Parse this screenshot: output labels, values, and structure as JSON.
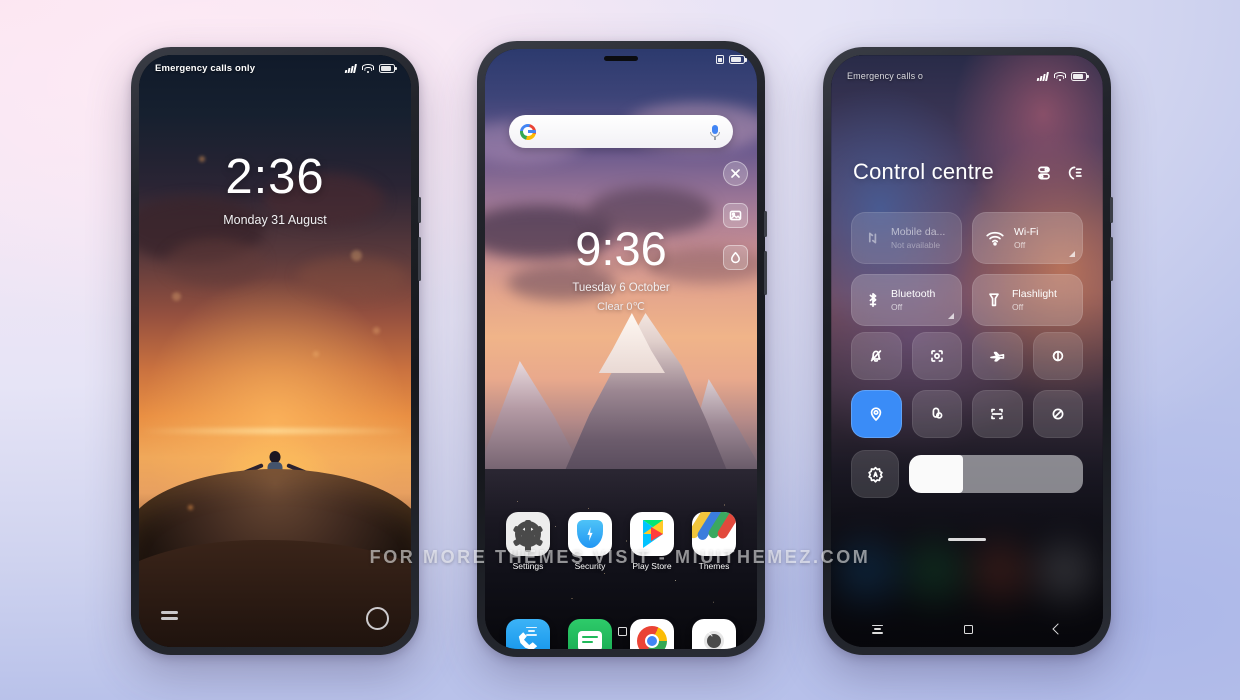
{
  "page": {
    "watermark": "FOR MORE THEMES VISIT - MIUITHEMEZ.COM",
    "bg_start": "#fae1ee",
    "bg_end": "#b6c0ea"
  },
  "lockscreen": {
    "status": {
      "carrier": "Emergency calls only"
    },
    "time": "2:36",
    "date": "Monday 31 August",
    "bottom_left_icon": "menu-icon",
    "bottom_right_icon": "camera-icon"
  },
  "homescreen": {
    "search": {
      "placeholder": "",
      "logo_icon": "google-icon",
      "mic_icon": "microphone-icon"
    },
    "time": "9:36",
    "date": "Tuesday 6 October",
    "weather": "Clear  0℃",
    "rail": [
      {
        "name": "close-icon"
      },
      {
        "name": "gallery-icon"
      },
      {
        "name": "blur-icon"
      }
    ],
    "apps": [
      {
        "label": "Settings",
        "icon": "gear-icon"
      },
      {
        "label": "Security",
        "icon": "shield-icon"
      },
      {
        "label": "Play Store",
        "icon": "play-store-icon"
      },
      {
        "label": "Themes",
        "icon": "themes-icon"
      }
    ],
    "dock": [
      {
        "label": "Phone",
        "icon": "phone-icon"
      },
      {
        "label": "Messages",
        "icon": "message-icon"
      },
      {
        "label": "Chrome",
        "icon": "chrome-icon"
      },
      {
        "label": "Camera",
        "icon": "camera-icon"
      }
    ]
  },
  "controlcentre": {
    "status": {
      "carrier": "Emergency calls o"
    },
    "title": "Control centre",
    "actions": [
      {
        "name": "settings-sliders-icon"
      },
      {
        "name": "edit-icon"
      }
    ],
    "big_tiles": [
      {
        "name": "Mobile da...",
        "status": "Not available",
        "icon": "mobile-data-icon",
        "enabled": false,
        "expandable": false
      },
      {
        "name": "Wi-Fi",
        "status": "Off",
        "icon": "wifi-icon",
        "enabled": true,
        "expandable": true
      },
      {
        "name": "Bluetooth",
        "status": "Off",
        "icon": "bluetooth-icon",
        "enabled": true,
        "expandable": true
      },
      {
        "name": "Flashlight",
        "status": "Off",
        "icon": "flashlight-icon",
        "enabled": true,
        "expandable": false
      }
    ],
    "quick_toggles": [
      {
        "name": "silent-bell-icon",
        "active": false
      },
      {
        "name": "screenshot-icon",
        "active": false
      },
      {
        "name": "airplane-mode-icon",
        "active": false
      },
      {
        "name": "dark-mode-icon",
        "active": false
      },
      {
        "name": "location-icon",
        "active": true
      },
      {
        "name": "do-not-disturb-icon",
        "active": false
      },
      {
        "name": "scan-qr-icon",
        "active": false
      },
      {
        "name": "sync-icon",
        "active": false
      }
    ],
    "brightness": {
      "auto_icon": "auto-brightness-icon",
      "value": 31
    },
    "accent_on": "#3a8cf7"
  },
  "navbar": {
    "recents_icon": "recents-icon",
    "home_icon": "home-icon",
    "back_icon": "back-icon"
  }
}
